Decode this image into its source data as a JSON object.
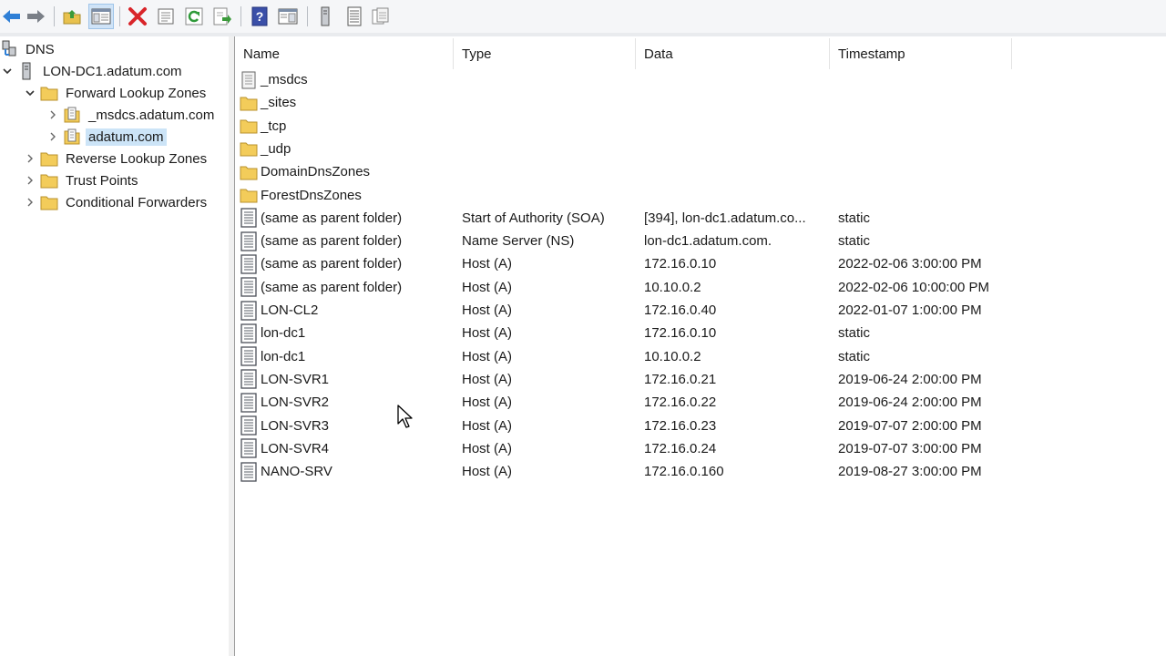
{
  "toolbar": {
    "buttons": [
      {
        "icon": "back-arrow-icon"
      },
      {
        "icon": "forward-arrow-icon"
      },
      {
        "icon": "up-folder-icon"
      },
      {
        "icon": "show-hide-console-tree-icon"
      },
      {
        "icon": "delete-icon"
      },
      {
        "icon": "properties-icon"
      },
      {
        "icon": "refresh-icon"
      },
      {
        "icon": "export-list-icon"
      },
      {
        "icon": "help-icon"
      },
      {
        "icon": "show-action-pane-icon"
      },
      {
        "icon": "server-icon"
      },
      {
        "icon": "record-list-icon"
      },
      {
        "icon": "copy-icon"
      }
    ]
  },
  "tree": {
    "root": "DNS",
    "server": "LON-DC1.adatum.com",
    "forward_zones": "Forward Lookup Zones",
    "zone_msdcs": "_msdcs.adatum.com",
    "zone_adatum": "adatum.com",
    "reverse_zones": "Reverse Lookup Zones",
    "trust_points": "Trust Points",
    "conditional_forwarders": "Conditional Forwarders"
  },
  "list": {
    "columns": [
      "Name",
      "Type",
      "Data",
      "Timestamp"
    ],
    "rows": [
      {
        "icon": "zone-icon",
        "name": "_msdcs",
        "type": "",
        "data": "",
        "timestamp": ""
      },
      {
        "icon": "folder-icon",
        "name": "_sites",
        "type": "",
        "data": "",
        "timestamp": ""
      },
      {
        "icon": "folder-icon",
        "name": "_tcp",
        "type": "",
        "data": "",
        "timestamp": ""
      },
      {
        "icon": "folder-icon",
        "name": "_udp",
        "type": "",
        "data": "",
        "timestamp": ""
      },
      {
        "icon": "folder-icon",
        "name": "DomainDnsZones",
        "type": "",
        "data": "",
        "timestamp": ""
      },
      {
        "icon": "folder-icon",
        "name": "ForestDnsZones",
        "type": "",
        "data": "",
        "timestamp": ""
      },
      {
        "icon": "record-icon",
        "name": "(same as parent folder)",
        "type": "Start of Authority (SOA)",
        "data": "[394], lon-dc1.adatum.co...",
        "timestamp": "static"
      },
      {
        "icon": "record-icon",
        "name": "(same as parent folder)",
        "type": "Name Server (NS)",
        "data": "lon-dc1.adatum.com.",
        "timestamp": "static"
      },
      {
        "icon": "record-icon",
        "name": "(same as parent folder)",
        "type": "Host (A)",
        "data": "172.16.0.10",
        "timestamp": "2022-02-06 3:00:00 PM"
      },
      {
        "icon": "record-icon",
        "name": "(same as parent folder)",
        "type": "Host (A)",
        "data": "10.10.0.2",
        "timestamp": "2022-02-06 10:00:00 PM"
      },
      {
        "icon": "record-icon",
        "name": "LON-CL2",
        "type": "Host (A)",
        "data": "172.16.0.40",
        "timestamp": "2022-01-07 1:00:00 PM"
      },
      {
        "icon": "record-icon",
        "name": "lon-dc1",
        "type": "Host (A)",
        "data": "172.16.0.10",
        "timestamp": "static"
      },
      {
        "icon": "record-icon",
        "name": "lon-dc1",
        "type": "Host (A)",
        "data": "10.10.0.2",
        "timestamp": "static"
      },
      {
        "icon": "record-icon",
        "name": "LON-SVR1",
        "type": "Host (A)",
        "data": "172.16.0.21",
        "timestamp": "2019-06-24 2:00:00 PM"
      },
      {
        "icon": "record-icon",
        "name": "LON-SVR2",
        "type": "Host (A)",
        "data": "172.16.0.22",
        "timestamp": "2019-06-24 2:00:00 PM"
      },
      {
        "icon": "record-icon",
        "name": "LON-SVR3",
        "type": "Host (A)",
        "data": "172.16.0.23",
        "timestamp": "2019-07-07 2:00:00 PM"
      },
      {
        "icon": "record-icon",
        "name": "LON-SVR4",
        "type": "Host (A)",
        "data": "172.16.0.24",
        "timestamp": "2019-07-07 3:00:00 PM"
      },
      {
        "icon": "record-icon",
        "name": "NANO-SRV",
        "type": "Host (A)",
        "data": "172.16.0.160",
        "timestamp": "2019-08-27 3:00:00 PM"
      }
    ]
  },
  "colors": {
    "selection": "#cce4f7",
    "folder": "#f3cc5a",
    "delete": "#d9252a",
    "nav_arrow": "#2f7fd6"
  }
}
